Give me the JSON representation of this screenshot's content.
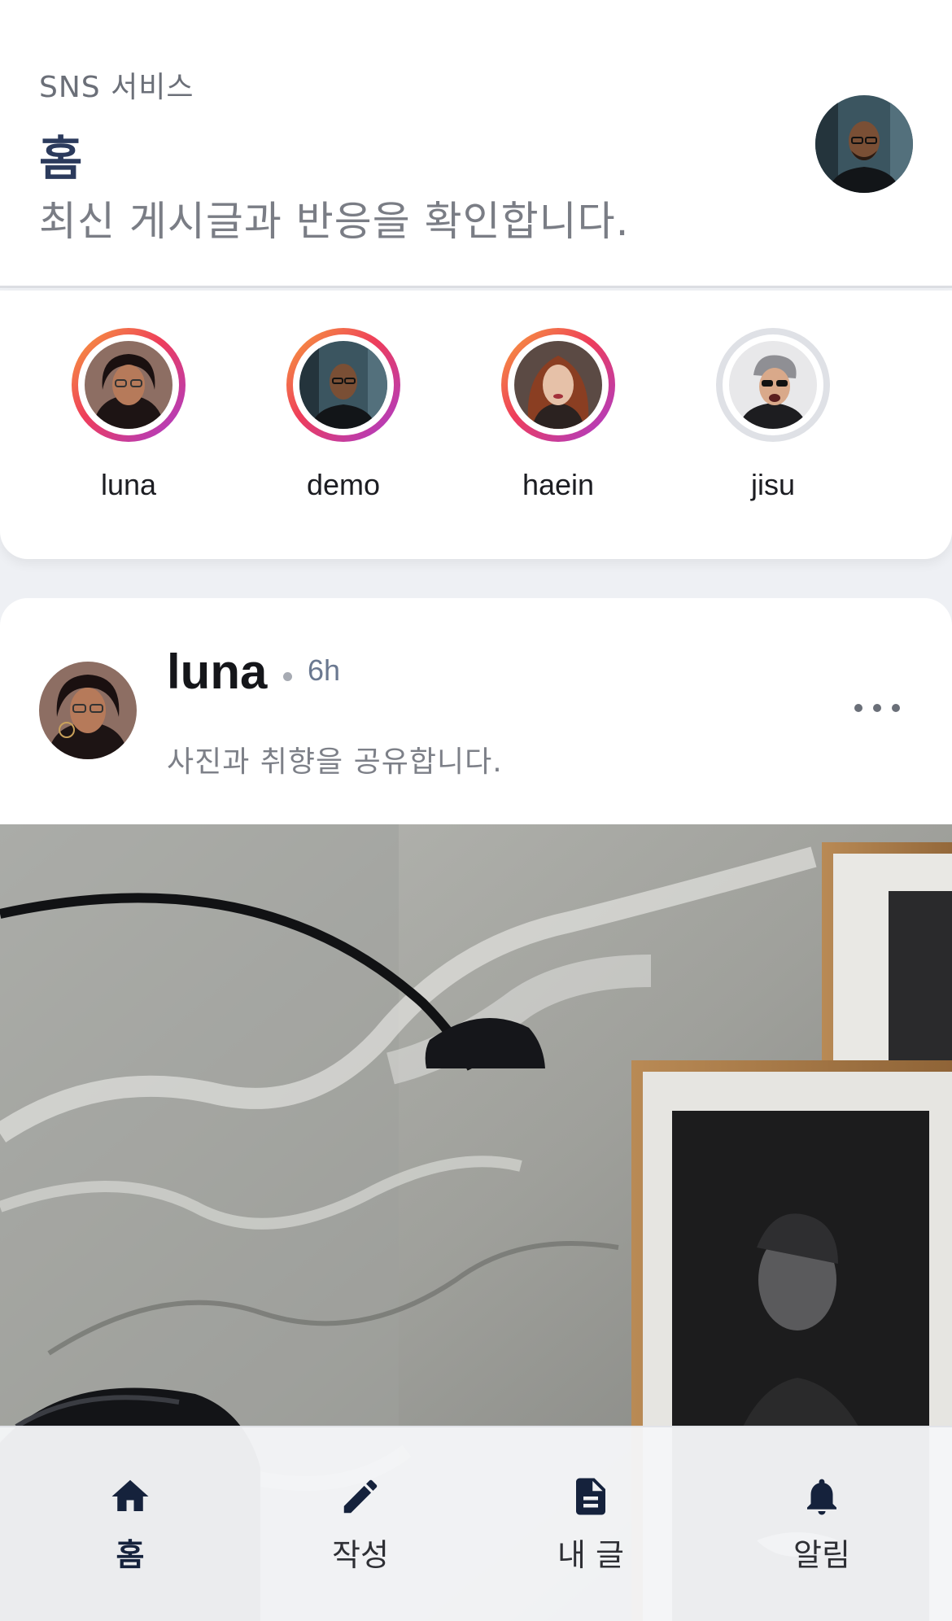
{
  "header": {
    "kicker": "SNS 서비스",
    "title": "홈",
    "subtitle": "최신 게시글과 반응을 확인합니다."
  },
  "stories": [
    {
      "name": "luna",
      "seen": false
    },
    {
      "name": "demo",
      "seen": false
    },
    {
      "name": "haein",
      "seen": false
    },
    {
      "name": "jisu",
      "seen": true
    }
  ],
  "post": {
    "author": "luna",
    "time": "6h",
    "caption": "사진과 취향을 공유합니다."
  },
  "nav": {
    "items": [
      {
        "label": "홈",
        "icon": "home-icon",
        "active": true
      },
      {
        "label": "작성",
        "icon": "pencil-icon",
        "active": false
      },
      {
        "label": "내 글",
        "icon": "document-icon",
        "active": false
      },
      {
        "label": "알림",
        "icon": "bell-icon",
        "active": false
      }
    ]
  },
  "colors": {
    "accent": "#2b3a5c",
    "story_ring_start": "#f7a23a",
    "story_ring_end": "#a63bd1",
    "story_ring_seen": "#dfe1e6"
  }
}
